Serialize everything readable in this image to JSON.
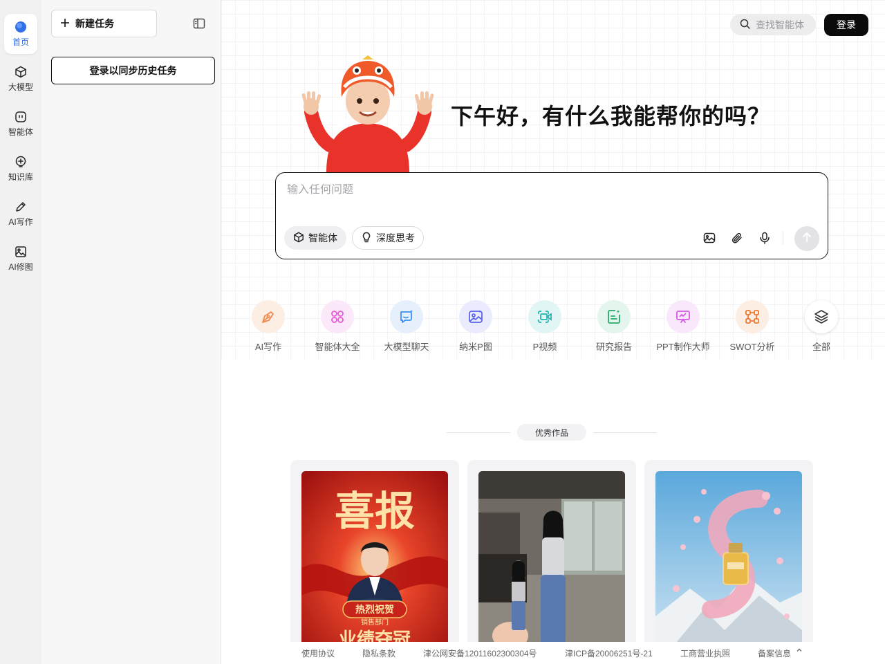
{
  "rail": {
    "items": [
      {
        "label": "首页",
        "icon": "home-icon",
        "active": true
      },
      {
        "label": "大模型",
        "icon": "cube-icon"
      },
      {
        "label": "智能体",
        "icon": "bot-icon"
      },
      {
        "label": "知识库",
        "icon": "knowledge-icon"
      },
      {
        "label": "AI写作",
        "icon": "pen-icon"
      },
      {
        "label": "AI修图",
        "icon": "image-icon"
      }
    ]
  },
  "sidebar": {
    "new_task": "新建任务",
    "login_sync": "登录以同步历史任务"
  },
  "header": {
    "search_placeholder": "查找智能体",
    "login": "登录"
  },
  "greeting": "下午好，有什么我能帮你的吗？",
  "composer": {
    "placeholder": "输入任何问题",
    "chips": [
      "智能体",
      "深度思考"
    ]
  },
  "shortcuts": [
    {
      "label": "AI写作",
      "icon": "pen-nib-icon",
      "color": "#f08a4b",
      "bg": "#fdeee4"
    },
    {
      "label": "智能体大全",
      "icon": "grid-icon",
      "color": "#e45bd6",
      "bg": "#fbe8f8"
    },
    {
      "label": "大模型聊天",
      "icon": "chat-icon",
      "color": "#3b8ff3",
      "bg": "#e6f0fd"
    },
    {
      "label": "纳米P图",
      "icon": "photo-edit-icon",
      "color": "#5b67e8",
      "bg": "#eaebfc"
    },
    {
      "label": "P视频",
      "icon": "video-icon",
      "color": "#23b3b1",
      "bg": "#e2f5f5"
    },
    {
      "label": "研究报告",
      "icon": "report-icon",
      "color": "#28a86a",
      "bg": "#e3f5ec"
    },
    {
      "label": "PPT制作大师",
      "icon": "slides-icon",
      "color": "#d659e6",
      "bg": "#f9e8fb"
    },
    {
      "label": "SWOT分析",
      "icon": "nodes-icon",
      "color": "#ec7b34",
      "bg": "#fdeee3"
    },
    {
      "label": "全部",
      "icon": "layers-icon",
      "color": "#333333",
      "bg": "#ffffff"
    }
  ],
  "section_title": "优秀作品",
  "works": [
    {
      "title": "喜报",
      "subtitle": "热烈祝贺",
      "line": "销售部门",
      "bottom": "业绩夺冠"
    },
    {
      "title": ""
    },
    {
      "title": ""
    }
  ],
  "footer": [
    "使用协议",
    "隐私条款",
    "津公网安备12011602300304号",
    "津ICP备20006251号-21",
    "工商营业执照",
    "备案信息"
  ]
}
